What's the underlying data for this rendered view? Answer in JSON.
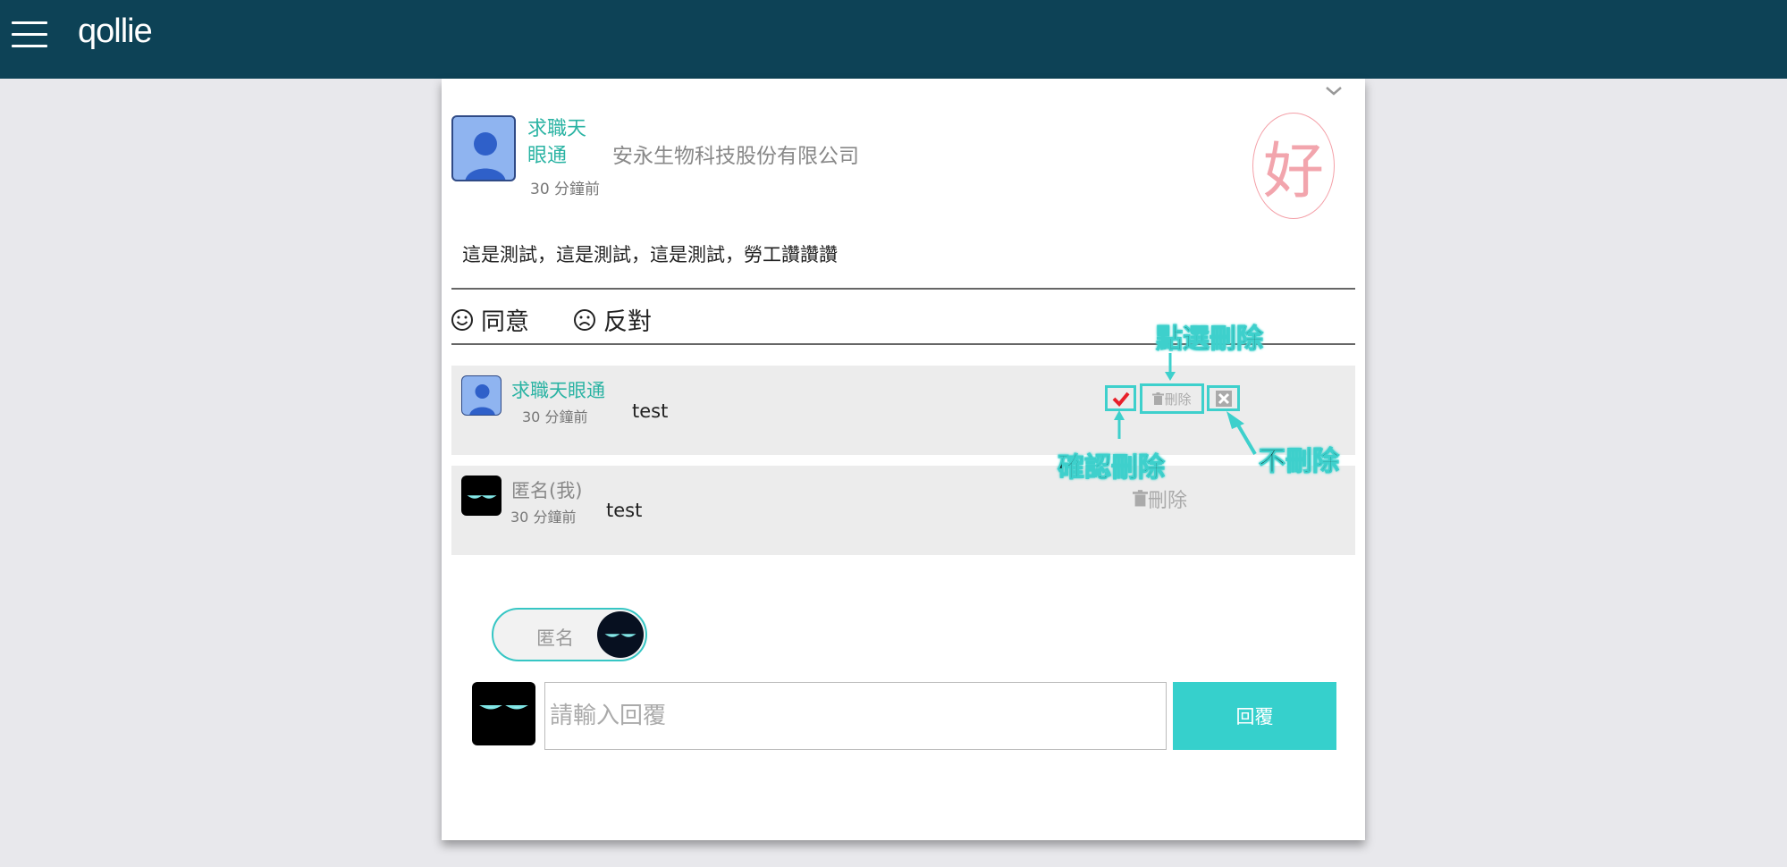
{
  "app": {
    "logo": "qollie"
  },
  "post": {
    "author": "求職天眼通",
    "company": "安永生物科技股份有限公司",
    "time": "30 分鐘前",
    "stamp": "好",
    "body": "這是測試，這是測試，這是測試，勞工讚讚讚"
  },
  "reactions": {
    "agree": "同意",
    "disagree": "反對"
  },
  "comments": [
    {
      "author": "求職天眼通",
      "time": "30 分鐘前",
      "text": "test",
      "delete_label": "刪除"
    },
    {
      "author": "匿名(我)",
      "time": "30 分鐘前",
      "text": "test",
      "delete_label": "刪除"
    }
  ],
  "annotations": {
    "click_delete": "點選刪除",
    "confirm_delete": "確認刪除",
    "cancel_delete": "不刪除"
  },
  "anon_toggle": {
    "label": "匿名"
  },
  "reply": {
    "placeholder": "請輸入回覆",
    "button": "回覆"
  },
  "colors": {
    "topbar": "#0d4256",
    "accent": "#36d0cc",
    "author": "#2ab3a3",
    "confirm": "#e8202a",
    "stamp": "#f2a5ad"
  }
}
